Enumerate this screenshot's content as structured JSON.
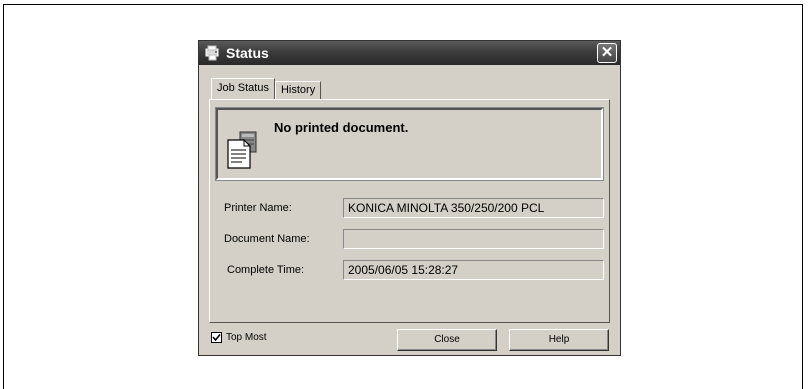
{
  "window": {
    "title": "Status",
    "close_glyph": "✕"
  },
  "tabs": [
    {
      "label": "Job Status",
      "active": true
    },
    {
      "label": "History",
      "active": false
    }
  ],
  "status": {
    "message": "No printed document.",
    "icon": "printer-document-icon"
  },
  "fields": {
    "printer_name": {
      "label": "Printer Name:",
      "value": "KONICA MINOLTA 350/250/200 PCL"
    },
    "document_name": {
      "label": "Document Name:",
      "value": ""
    },
    "complete_time": {
      "label": "Complete Time:",
      "value": "2005/06/05 15:28:27"
    }
  },
  "footer": {
    "top_most_label": "Top Most",
    "top_most_checked": true,
    "close_label": "Close",
    "help_label": "Help"
  }
}
